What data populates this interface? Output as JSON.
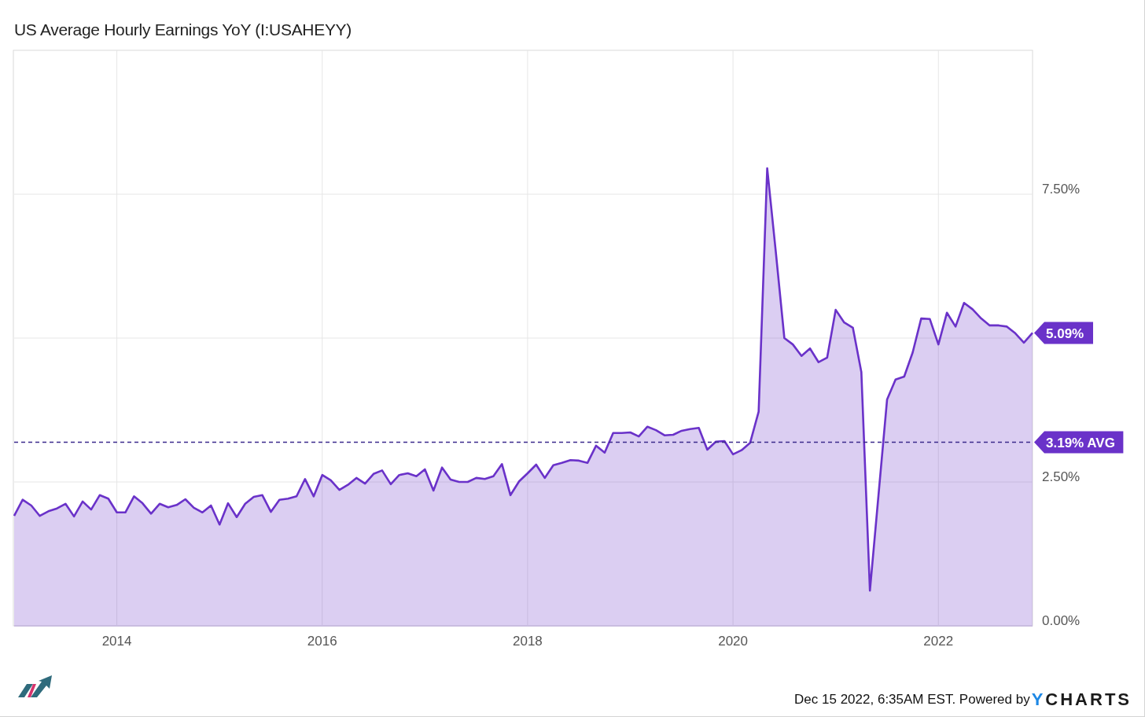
{
  "chart_data": {
    "type": "area",
    "title": "US Average Hourly Earnings YoY (I:USAHEYY)",
    "x": [
      2013,
      2013.083,
      2013.167,
      2013.25,
      2013.333,
      2013.417,
      2013.5,
      2013.583,
      2013.667,
      2013.75,
      2013.833,
      2013.917,
      2014,
      2014.083,
      2014.167,
      2014.25,
      2014.333,
      2014.417,
      2014.5,
      2014.583,
      2014.667,
      2014.75,
      2014.833,
      2014.917,
      2015,
      2015.083,
      2015.167,
      2015.25,
      2015.333,
      2015.417,
      2015.5,
      2015.583,
      2015.667,
      2015.75,
      2015.833,
      2015.917,
      2016,
      2016.083,
      2016.167,
      2016.25,
      2016.333,
      2016.417,
      2016.5,
      2016.583,
      2016.667,
      2016.75,
      2016.833,
      2016.917,
      2017,
      2017.083,
      2017.167,
      2017.25,
      2017.333,
      2017.417,
      2017.5,
      2017.583,
      2017.667,
      2017.75,
      2017.833,
      2017.917,
      2018,
      2018.083,
      2018.167,
      2018.25,
      2018.333,
      2018.417,
      2018.5,
      2018.583,
      2018.667,
      2018.75,
      2018.833,
      2018.917,
      2019,
      2019.083,
      2019.167,
      2019.25,
      2019.333,
      2019.417,
      2019.5,
      2019.583,
      2019.667,
      2019.75,
      2019.833,
      2019.917,
      2020,
      2020.083,
      2020.167,
      2020.25,
      2020.333,
      2020.417,
      2020.5,
      2020.583,
      2020.667,
      2020.75,
      2020.833,
      2020.917,
      2021,
      2021.083,
      2021.167,
      2021.25,
      2021.333,
      2021.417,
      2021.5,
      2021.583,
      2021.667,
      2021.75,
      2021.833,
      2021.917,
      2022,
      2022.083,
      2022.167,
      2022.25,
      2022.333,
      2022.417,
      2022.5,
      2022.583,
      2022.667,
      2022.75,
      2022.833,
      2022.917
    ],
    "series": [
      {
        "color": "#6a32c9",
        "values": [
          1.91,
          2.19,
          2.09,
          1.91,
          1.99,
          2.04,
          2.12,
          1.9,
          2.16,
          2.02,
          2.27,
          2.21,
          1.97,
          1.97,
          2.25,
          2.13,
          1.95,
          2.12,
          2.06,
          2.1,
          2.2,
          2.05,
          1.97,
          2.09,
          1.76,
          2.13,
          1.89,
          2.12,
          2.24,
          2.27,
          1.98,
          2.19,
          2.21,
          2.25,
          2.55,
          2.25,
          2.62,
          2.53,
          2.36,
          2.45,
          2.57,
          2.47,
          2.64,
          2.7,
          2.46,
          2.62,
          2.65,
          2.6,
          2.72,
          2.35,
          2.75,
          2.54,
          2.5,
          2.5,
          2.57,
          2.55,
          2.6,
          2.81,
          2.27,
          2.51,
          2.65,
          2.8,
          2.57,
          2.79,
          2.83,
          2.88,
          2.87,
          2.83,
          3.13,
          3.01,
          3.35,
          3.35,
          3.36,
          3.29,
          3.46,
          3.4,
          3.31,
          3.32,
          3.39,
          3.42,
          3.44,
          3.06,
          3.2,
          3.21,
          2.98,
          3.05,
          3.18,
          3.72,
          7.95,
          6.5,
          5.0,
          4.89,
          4.69,
          4.82,
          4.58,
          4.66,
          5.49,
          5.27,
          5.18,
          4.41,
          0.61,
          2.27,
          3.93,
          4.28,
          4.33,
          4.75,
          5.34,
          5.33,
          4.89,
          5.44,
          5.2,
          5.61,
          5.5,
          5.34,
          5.22,
          5.22,
          5.2,
          5.08,
          4.92,
          5.09
        ]
      }
    ],
    "xlim": [
      2013,
      2022.917
    ],
    "ylim": [
      0,
      10
    ],
    "grid": true,
    "xticks": [
      2014,
      2016,
      2018,
      2020,
      2022
    ],
    "yticks": [
      {
        "value": 0,
        "label": "0.00%"
      },
      {
        "value": 2.5,
        "label": "2.50%"
      },
      {
        "value": 7.5,
        "label": "7.50%"
      }
    ],
    "annotations": [
      {
        "text": "5.09%",
        "x": 2022.917,
        "y": 5.09
      }
    ],
    "ref_lines": [
      {
        "axis": "y",
        "value": 3.19,
        "label": "3.19% AVG"
      }
    ]
  },
  "footer": {
    "timestamp": "Dec 15 2022, 6:35AM EST. Powered by",
    "brand": "YCHARTS"
  }
}
